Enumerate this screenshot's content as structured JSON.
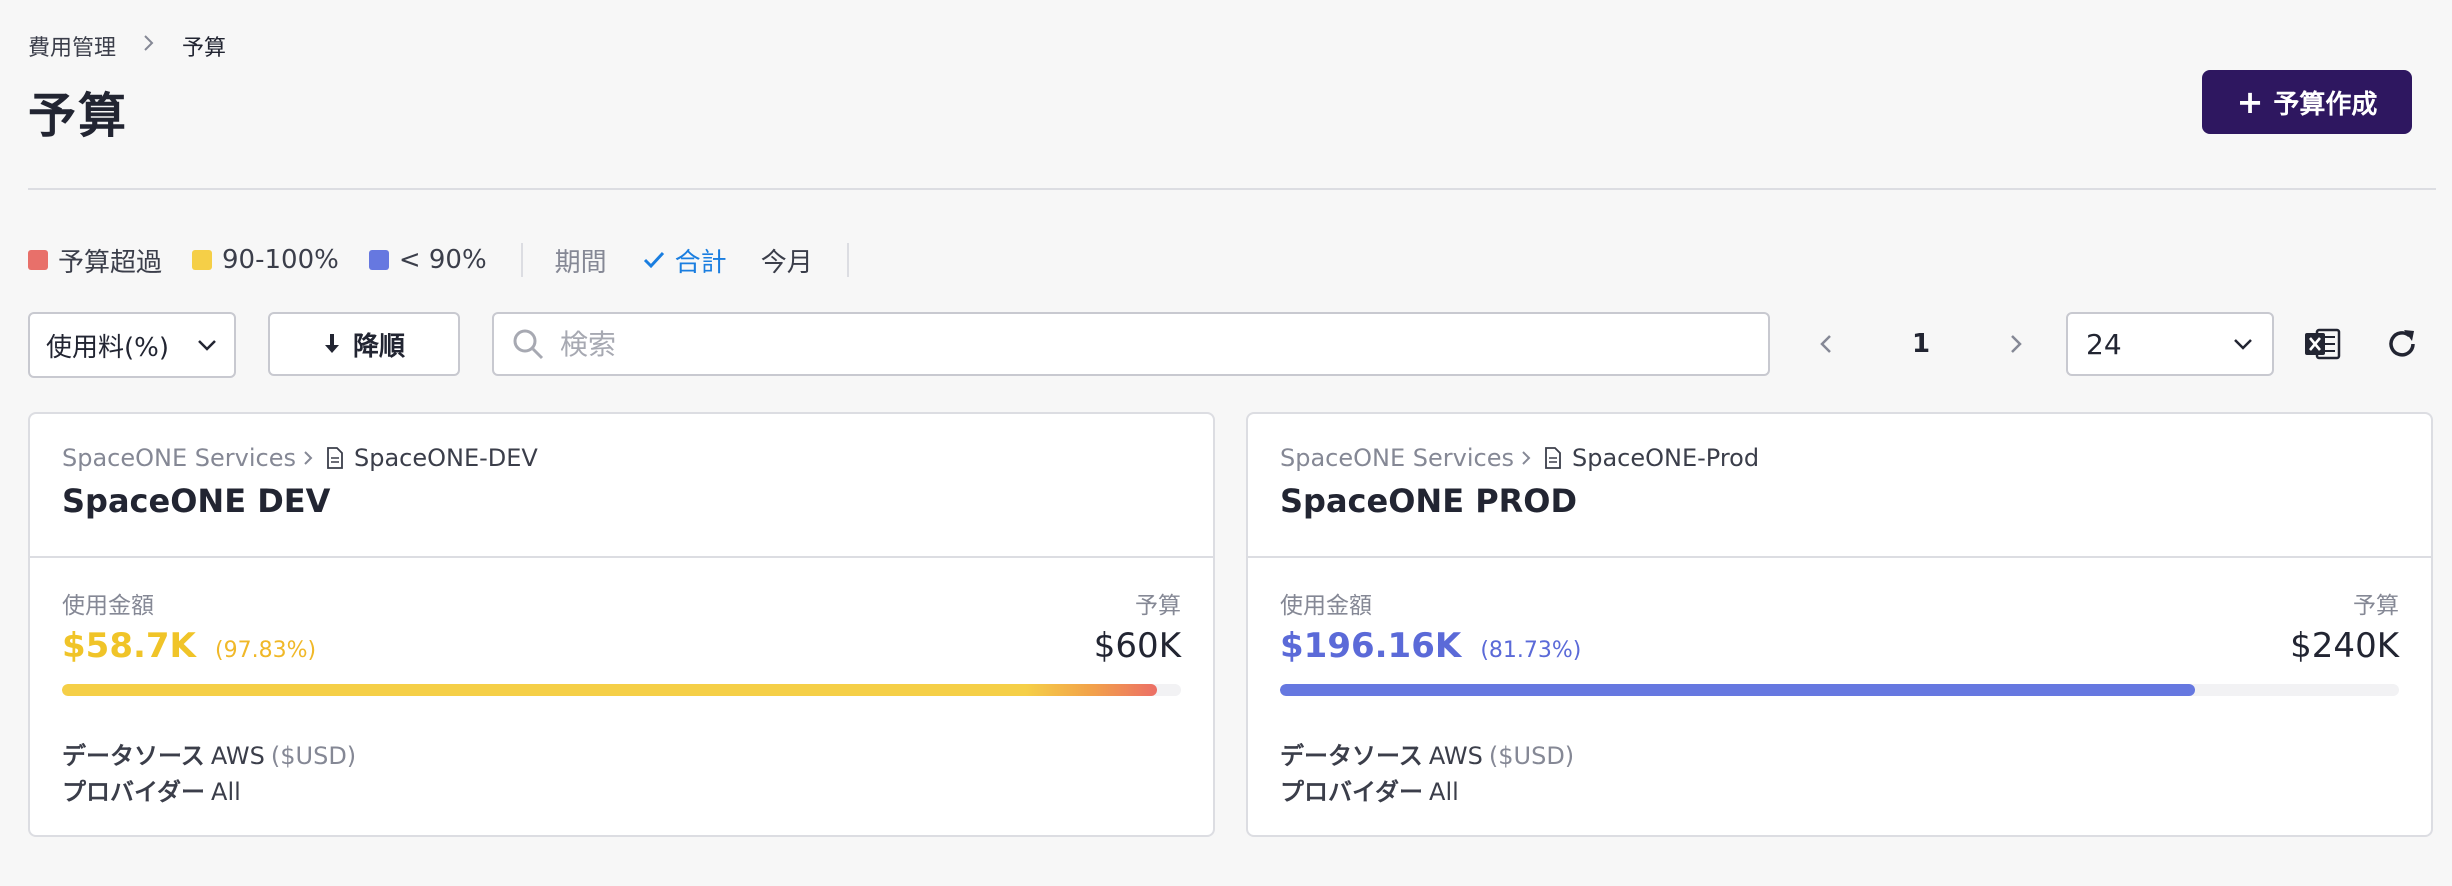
{
  "breadcrumb": {
    "parent": "費用管理",
    "current": "予算"
  },
  "page_title": "予算",
  "create_button": {
    "label": "予算作成"
  },
  "legend": [
    {
      "label": "予算超過",
      "color": "#e8706a"
    },
    {
      "label": "90-100%",
      "color": "#f5cf47"
    },
    {
      "label": "< 90%",
      "color": "#6678e0"
    }
  ],
  "period": {
    "label": "期間",
    "options": [
      "合計",
      "今月"
    ],
    "selected": "合計"
  },
  "controls": {
    "sort_select": "使用料(%)",
    "order_button": "降順",
    "search_placeholder": "検索",
    "page": "1",
    "page_size": "24"
  },
  "cards": [
    {
      "path_group": "SpaceONE Services",
      "path_project": "SpaceONE-DEV",
      "title": "SpaceONE DEV",
      "usage_label": "使用金額",
      "budget_label": "予算",
      "usage": "$58.7K",
      "percent_text": "(97.83%)",
      "percent": 97.83,
      "budget": "$60K",
      "status_color": "#f5cf47",
      "data_source_label": "データソース",
      "data_source": "AWS",
      "currency": "($USD)",
      "provider_label": "プロバイダー",
      "provider": "All"
    },
    {
      "path_group": "SpaceONE Services",
      "path_project": "SpaceONE-Prod",
      "title": "SpaceONE PROD",
      "usage_label": "使用金額",
      "budget_label": "予算",
      "usage": "$196.16K",
      "percent_text": "(81.73%)",
      "percent": 81.73,
      "budget": "$240K",
      "status_color": "#6678e0",
      "data_source_label": "データソース",
      "data_source": "AWS",
      "currency": "($USD)",
      "provider_label": "プロバイダー",
      "provider": "All"
    }
  ]
}
